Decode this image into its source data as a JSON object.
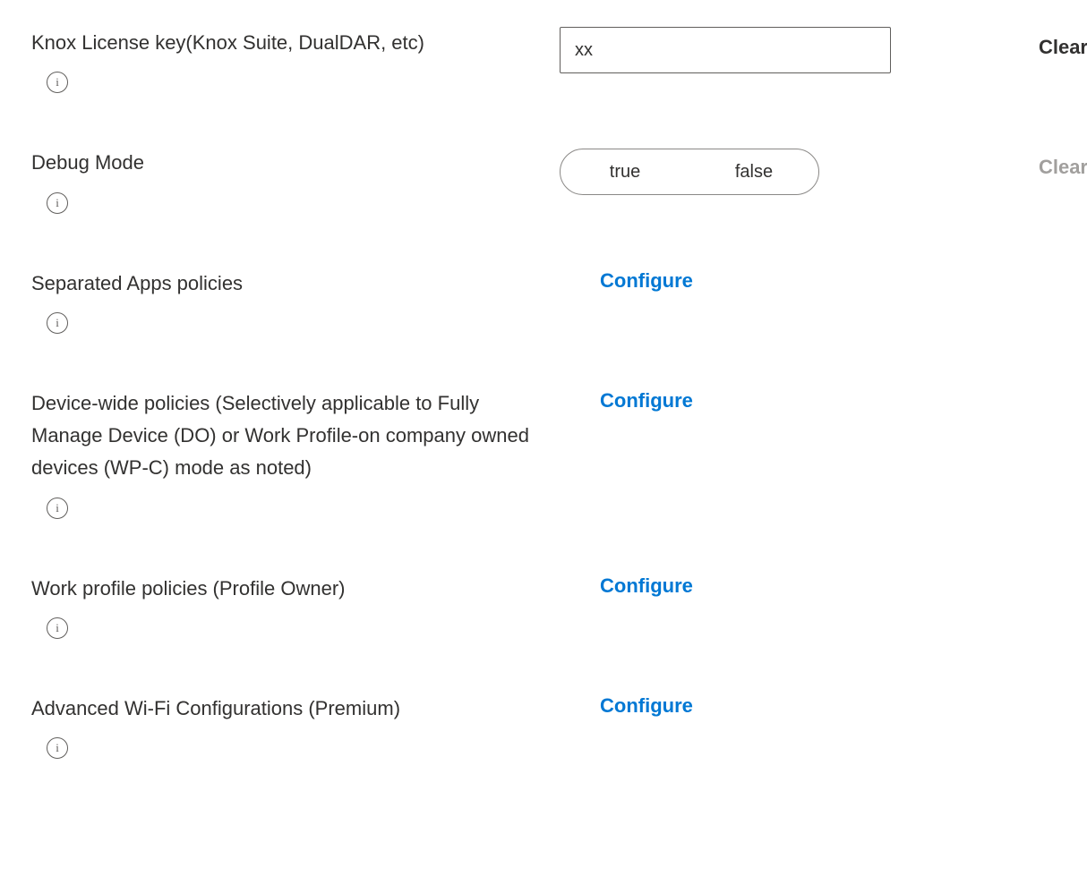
{
  "rows": [
    {
      "label": "Knox License key(Knox Suite, DualDAR, etc)",
      "type": "text",
      "value": "xx",
      "clear_label": "Clear",
      "clear_enabled": true
    },
    {
      "label": "Debug Mode",
      "type": "toggle",
      "option_true": "true",
      "option_false": "false",
      "clear_label": "Clear",
      "clear_enabled": false
    },
    {
      "label": "Separated Apps policies",
      "type": "configure",
      "configure_label": "Configure"
    },
    {
      "label": "Device-wide policies (Selectively applicable to Fully Manage Device (DO) or Work Profile-on company owned devices (WP-C) mode as noted)",
      "type": "configure",
      "configure_label": "Configure"
    },
    {
      "label": "Work profile policies (Profile Owner)",
      "type": "configure",
      "configure_label": "Configure"
    },
    {
      "label": "Advanced Wi-Fi Configurations (Premium)",
      "type": "configure",
      "configure_label": "Configure"
    }
  ],
  "info_glyph": "i"
}
